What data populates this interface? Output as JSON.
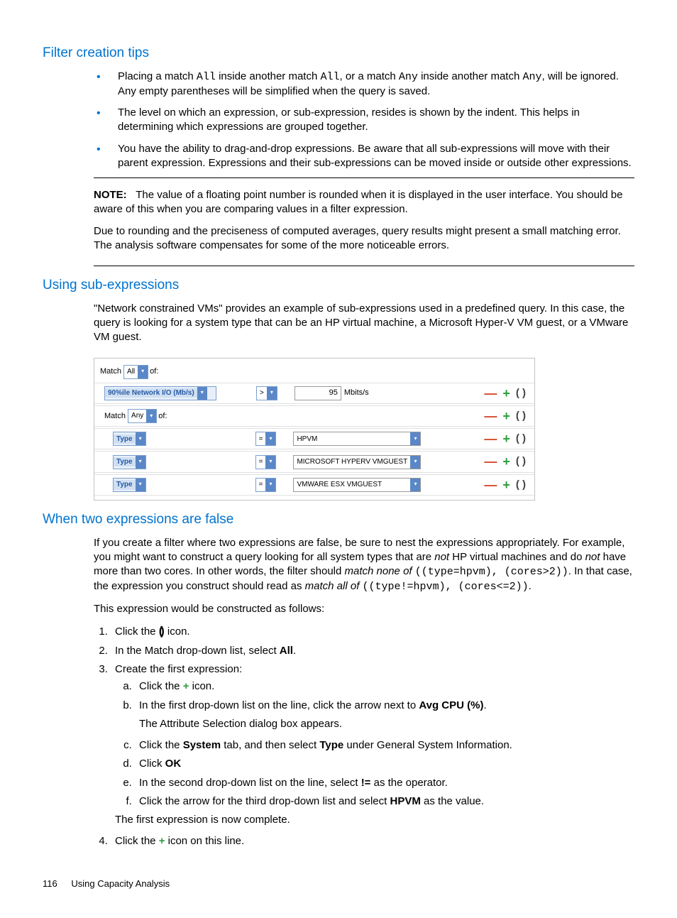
{
  "sec1": {
    "heading": "Filter creation tips",
    "bullets": [
      {
        "pre": "Placing a match ",
        "c1": "All",
        "mid": " inside another match ",
        "c2": "All",
        "mid2": ", or a match ",
        "c3": "Any",
        "mid3": " inside another match ",
        "c4": "Any",
        "post": ", will be ignored. Any empty parentheses will be simplified when the query is saved."
      },
      {
        "text": "The level on which an expression, or sub-expression, resides is shown by the indent. This helps in determining which expressions are grouped together."
      },
      {
        "text": "You have the ability to drag-and-drop expressions. Be aware that all sub-expressions will move with their parent expression. Expressions and their sub-expressions can be moved inside or outside other expressions."
      }
    ],
    "note_label": "NOTE:",
    "note_p1": "The value of a floating point number is rounded when it is displayed in the user interface. You should be aware of this when you are comparing values in a filter expression.",
    "note_p2": "Due to rounding and the preciseness of computed averages, query results might present a small matching error. The analysis software compensates for some of the more noticeable errors."
  },
  "sec2": {
    "heading": "Using sub-expressions",
    "p1": "\"Network constrained VMs\" provides an example of sub-expressions used in a predefined query. In this case, the query is looking for a system type that can be an HP virtual machine, a Microsoft Hyper-V VM guest, or a VMware VM guest.",
    "filter": {
      "match_all_label": "Match",
      "match_all_value": "All",
      "match_all_of": "of:",
      "row1": {
        "field": "90%ile Network I/O (Mb/s)",
        "op": ">",
        "val": "95",
        "unit": "Mbits/s"
      },
      "match_any_label": "Match",
      "match_any_value": "Any",
      "match_any_of": "of:",
      "rows": [
        {
          "field": "Type",
          "op": "=",
          "val": "HPVM"
        },
        {
          "field": "Type",
          "op": "=",
          "val": "MICROSOFT HYPERV VMGUEST"
        },
        {
          "field": "Type",
          "op": "=",
          "val": "VMWARE ESX VMGUEST"
        }
      ]
    }
  },
  "sec3": {
    "heading": "When two expressions are false",
    "p1_a": "If you create a filter where two expressions are false, be sure to nest the expressions appropriately. For example, you might want to construct a query looking for all system types that are ",
    "p1_not1": "not",
    "p1_b": " HP virtual machines and do ",
    "p1_not2": "not",
    "p1_c": " have more than two cores. In other words, the filter should ",
    "p1_mnone": "match none of",
    "p1_d": " ",
    "p1_code1": "((type=hpvm), (cores>2))",
    "p1_e": ". In that case, the expression you construct should read as ",
    "p1_mall": "match all of",
    "p1_f": " ",
    "p1_code2": "((type!=hpvm), (cores<=2))",
    "p1_g": ".",
    "p2": "This expression would be constructed as follows:",
    "steps": {
      "s1_a": "Click the ",
      "s1_b": " icon.",
      "s2_a": "In the Match drop-down list, select ",
      "s2_b": "All",
      "s2_c": ".",
      "s3": "Create the first expression:",
      "s3a_a": "Click the ",
      "s3a_b": " icon.",
      "s3b_a": "In the first drop-down list on the line, click the arrow next to ",
      "s3b_b": "Avg CPU (%)",
      "s3b_c": ".",
      "s3b_p": "The Attribute Selection dialog box appears.",
      "s3c_a": "Click the ",
      "s3c_b": "System",
      "s3c_c": " tab, and then select ",
      "s3c_d": "Type",
      "s3c_e": " under General System Information.",
      "s3d_a": "Click ",
      "s3d_b": "OK",
      "s3e_a": "In the second drop-down list on the line, select ",
      "s3e_b": "!=",
      "s3e_c": " as the operator.",
      "s3f_a": "Click the arrow for the third drop-down list and select ",
      "s3f_b": "HPVM",
      "s3f_c": " as the value.",
      "s3_p": "The first expression is now complete.",
      "s4_a": "Click the ",
      "s4_b": " icon on this line."
    }
  },
  "footer": {
    "page": "116",
    "title": "Using Capacity Analysis"
  }
}
